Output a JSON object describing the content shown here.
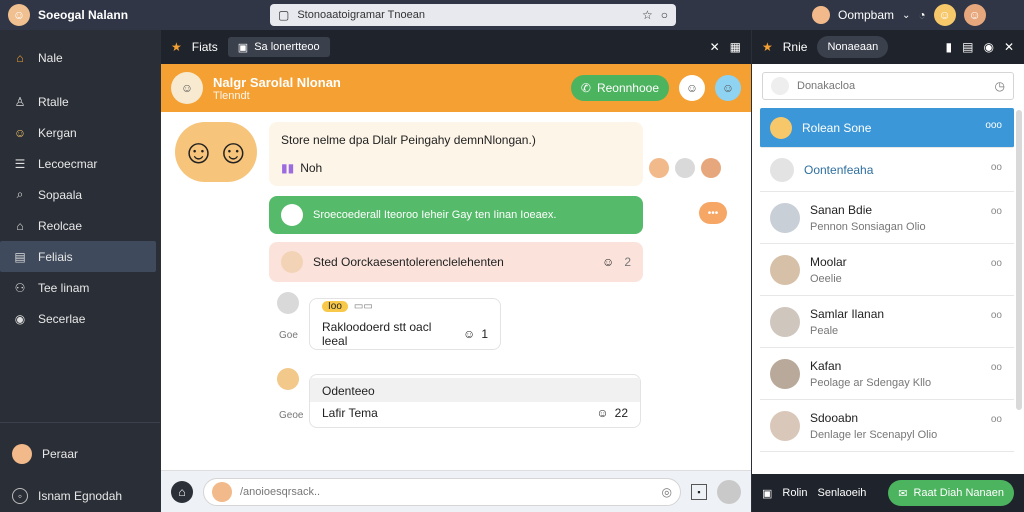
{
  "app": {
    "title": "Soeogal Nalann",
    "profile_name": "Oompbam",
    "url": "Stonoaatoigramar Tnoean"
  },
  "sidebar": {
    "items": [
      {
        "label": "Nale",
        "icon": "home-icon"
      },
      {
        "label": "Rtalle",
        "icon": "user-icon"
      },
      {
        "label": "Kergan",
        "icon": "avatar-icon"
      },
      {
        "label": "Lecoecmar",
        "icon": "list-icon"
      },
      {
        "label": "Sopaala",
        "icon": "search-icon"
      },
      {
        "label": "Reolcae",
        "icon": "house-icon"
      },
      {
        "label": "Feliais",
        "icon": "folder-icon"
      },
      {
        "label": "Tee linam",
        "icon": "team-icon"
      },
      {
        "label": "Secerlae",
        "icon": "settings-icon"
      }
    ],
    "active_index": 6,
    "bottom_user": "Peraar",
    "bottom_action": "Isnam Egnodah"
  },
  "chat": {
    "tab_label": "Fiats",
    "tab_pill": "Sa lonertteoo",
    "header_title": "Nalgr Sarolal Nlonan",
    "header_sub": "Tlenndt",
    "header_button": "Reonnhooe",
    "messages": {
      "m1_title": "Store nelme dpa Dlalr Peingahy demnNlongan.)",
      "m1_sub": "Noh",
      "m2": "Sroecoederall Iteoroo Ieheir Gay ten Iinan Ioeaex.",
      "m3": "Sted Oorckaesentolerenclelehenten",
      "m3_badge": "2",
      "m4_tag": "Ioo",
      "m4_text": "Rakloodoerd stt oacl leeal",
      "m4_badge": "1",
      "m4_time": "Goe",
      "m5_title": "Odenteeo",
      "m5_text": "Lafir Tema",
      "m5_badge": "22",
      "m5_time": "Geoe"
    },
    "input_placeholder": "/anoioesqrsack.."
  },
  "right_panel": {
    "top_label": "Rnie",
    "top_pill": "Nonaeaan",
    "search_placeholder": "Donakacloa",
    "contacts": [
      {
        "name": "Rolean Sone",
        "sub": "",
        "meta": "ooo",
        "active": true
      },
      {
        "name": "Oontenfeaha",
        "sub": "",
        "meta": "oo",
        "active": false
      },
      {
        "name": "Sanan Bdie",
        "sub": "Pennon Sonsiagan Olio",
        "meta": "oo",
        "active": false
      },
      {
        "name": "Moolar",
        "sub": "Oeelie",
        "meta": "oo",
        "active": false
      },
      {
        "name": "Samlar Ilanan",
        "sub": "Peale",
        "meta": "oo",
        "active": false
      },
      {
        "name": "Kafan",
        "sub": "Peolage ar Sdengay Kllo",
        "meta": "oo",
        "active": false
      },
      {
        "name": "Sdooabn",
        "sub": "Denlage ler Scenapyl Olio",
        "meta": "oo",
        "active": false
      }
    ],
    "bottom_left": "Rolin",
    "bottom_mid": "Senlaoeih",
    "bottom_button": "Raat Diah Nanaen"
  },
  "colors": {
    "accent_orange": "#f4a033",
    "accent_blue": "#3b97d8",
    "green": "#4cb35f"
  }
}
